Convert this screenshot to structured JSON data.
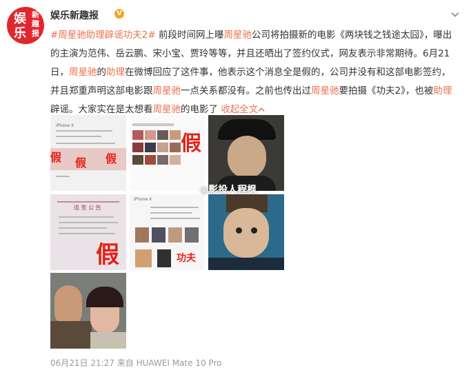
{
  "account": {
    "avatar_glyphs": [
      "娱",
      "乐",
      "新",
      "趣",
      "报"
    ],
    "name": "娱乐新趣报",
    "badge_icon": "gold-verified-icon",
    "badge_color": "#f5a623"
  },
  "post": {
    "hashtag": "#周星驰助理辟谣功夫2#",
    "text1": " 前段时间网上曝",
    "hl1": "周星驰",
    "text2": "公司将拍摄新的电影《两块钱之钱途太囧》，曝出的主演为范伟、岳云鹏、宋小宝、贾玲等等，并且还晒出了签约仪式，网友表示非常期待。6月21日，",
    "hl2": "周星驰",
    "text3": "的",
    "hl3": "助理",
    "text4": "在微博回应了这件事，他表示这个消息全是假的，公司并没有和这部电影签约，并且郑重声明这部电影跟",
    "hl4": "周星驰",
    "text5": "一点关系都没有。之前也传出过",
    "hl5": "周星驰",
    "text6": "要拍摄《功夫2》，也被",
    "hl6": "助理",
    "text7": "辟谣。大家实在是太想看",
    "hl7": "周星驰",
    "text8": "的电影了 ",
    "more": "收起全文",
    "more_icon": "chevron-up-icon",
    "link_color": "#eb7350"
  },
  "images": {
    "fake_label": "假",
    "t1_caption": "iPhone X",
    "t5_caption": "iPhone X",
    "t4_notice": "追 签 公 告",
    "t5_stamp": "功夫",
    "watermark": "◎影投人程枫"
  },
  "footer": {
    "time": "06月21日 21:27",
    "source": " 来自 HUAWEI Mate 10 Pro"
  }
}
